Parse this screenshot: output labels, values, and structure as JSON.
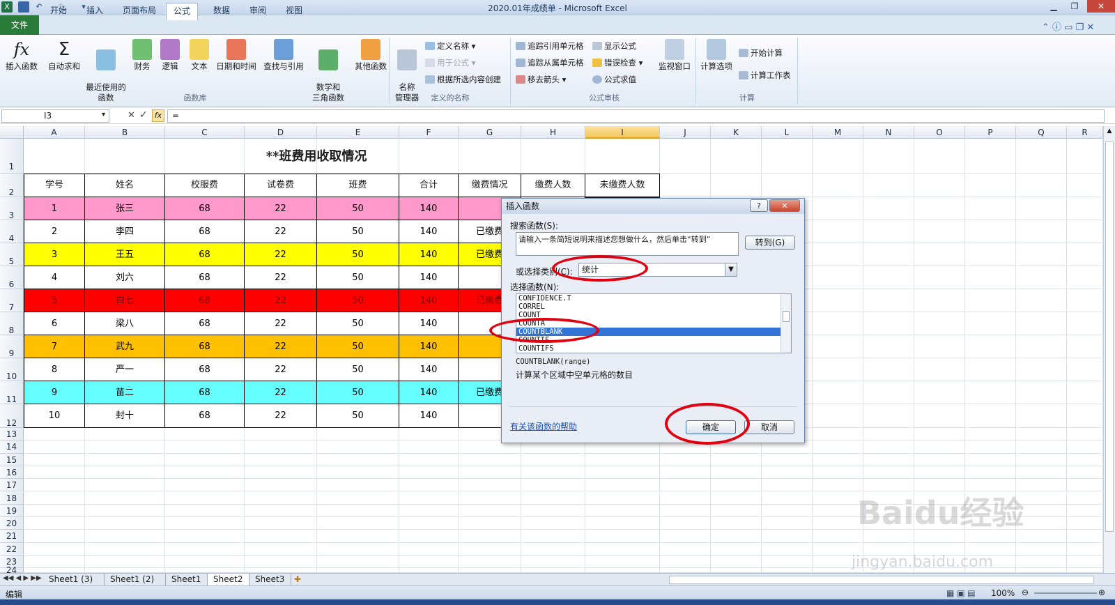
{
  "window": {
    "title": "2020.01年成绩单 - Microsoft Excel"
  },
  "ribbon_tabs": [
    "文件",
    "开始",
    "插入",
    "页面布局",
    "公式",
    "数据",
    "审阅",
    "视图"
  ],
  "active_tab": "公式",
  "ribbon": {
    "insert_function": "插入函数",
    "autosum": "自动求和",
    "recent_fn": "最近使用的\n函数",
    "financial": "财务",
    "logical": "逻辑",
    "text": "文本",
    "datetime": "日期和时间",
    "lookup": "查找与引用",
    "math": "数学和\n三角函数",
    "more": "其他函数",
    "group_library": "函数库",
    "name_manager": "名称\n管理器",
    "define_name": "定义名称",
    "use_in_formula": "用于公式",
    "create_from_sel": "根据所选内容创建",
    "group_names": "定义的名称",
    "trace_precedents": "追踪引用单元格",
    "trace_dependents": "追踪从属单元格",
    "remove_arrows": "移去箭头",
    "show_formulas": "显示公式",
    "error_check": "错误检查",
    "eval_formula": "公式求值",
    "watch_window": "监视窗口",
    "group_audit": "公式审核",
    "calc_options": "计算选项",
    "calc_now": "开始计算",
    "calc_sheet": "计算工作表",
    "group_calc": "计算"
  },
  "formula_bar": {
    "name_box": "I3",
    "formula": "="
  },
  "columns": [
    "A",
    "B",
    "C",
    "D",
    "E",
    "F",
    "G",
    "H",
    "I",
    "J",
    "K",
    "L",
    "M",
    "N",
    "O",
    "P",
    "Q",
    "R"
  ],
  "selected_column": "I",
  "sheet": {
    "title": "**班费用收取情况",
    "headers": [
      "学号",
      "姓名",
      "校服费",
      "试卷费",
      "班费",
      "合计",
      "缴费情况",
      "缴费人数",
      "未缴费人数"
    ],
    "rows": [
      {
        "cells": [
          "1",
          "张三",
          "68",
          "22",
          "50",
          "140",
          ""
        ],
        "color": "#ff99cc"
      },
      {
        "cells": [
          "2",
          "李四",
          "68",
          "22",
          "50",
          "140",
          "已缴费"
        ],
        "color": "#ffffff"
      },
      {
        "cells": [
          "3",
          "王五",
          "68",
          "22",
          "50",
          "140",
          "已缴费"
        ],
        "color": "#ffff00"
      },
      {
        "cells": [
          "4",
          "刘六",
          "68",
          "22",
          "50",
          "140",
          ""
        ],
        "color": "#ffffff"
      },
      {
        "cells": [
          "5",
          "白七",
          "68",
          "22",
          "50",
          "140",
          "已缴费"
        ],
        "color": "#ff0000"
      },
      {
        "cells": [
          "6",
          "梁八",
          "68",
          "22",
          "50",
          "140",
          ""
        ],
        "color": "#ffffff"
      },
      {
        "cells": [
          "7",
          "武九",
          "68",
          "22",
          "50",
          "140",
          ""
        ],
        "color": "#ffc000"
      },
      {
        "cells": [
          "8",
          "严一",
          "68",
          "22",
          "50",
          "140",
          ""
        ],
        "color": "#ffffff"
      },
      {
        "cells": [
          "9",
          "苗二",
          "68",
          "22",
          "50",
          "140",
          "已缴费"
        ],
        "color": "#66ffff"
      },
      {
        "cells": [
          "10",
          "封十",
          "68",
          "22",
          "50",
          "140",
          ""
        ],
        "color": "#ffffff"
      }
    ],
    "row_numbers": [
      "1",
      "2",
      "3",
      "4",
      "5",
      "6",
      "7",
      "8",
      "9",
      "10",
      "11",
      "12",
      "13",
      "14",
      "15",
      "16",
      "17",
      "18",
      "19",
      "20",
      "21",
      "22",
      "23",
      "24"
    ]
  },
  "dialog": {
    "title": "插入函数",
    "search_label": "搜索函数(S):",
    "search_value": "请输入一条简短说明来描述您想做什么，然后单击“转到”",
    "go_button": "转到(G)",
    "category_label": "或选择类别(C):",
    "category_value": "统计",
    "select_label": "选择函数(N):",
    "functions": [
      "CONFIDENCE.T",
      "CORREL",
      "COUNT",
      "COUNTA",
      "COUNTBLANK",
      "COUNTIF",
      "COUNTIFS"
    ],
    "selected_function": "COUNTBLANK",
    "signature": "COUNTBLANK(range)",
    "description": "计算某个区域中空单元格的数目",
    "help_link": "有关该函数的帮助",
    "ok": "确定",
    "cancel": "取消",
    "help_glyph": "?",
    "close_glyph": "✕"
  },
  "sheet_tabs": [
    "Sheet1 (3)",
    "Sheet1 (2)",
    "Sheet1",
    "Sheet2",
    "Sheet3"
  ],
  "active_sheet": "Sheet2",
  "status": {
    "mode": "编辑",
    "zoom": "100%"
  },
  "watermark": {
    "logo": "Baidu经验",
    "url": "jingyan.baidu.com"
  }
}
